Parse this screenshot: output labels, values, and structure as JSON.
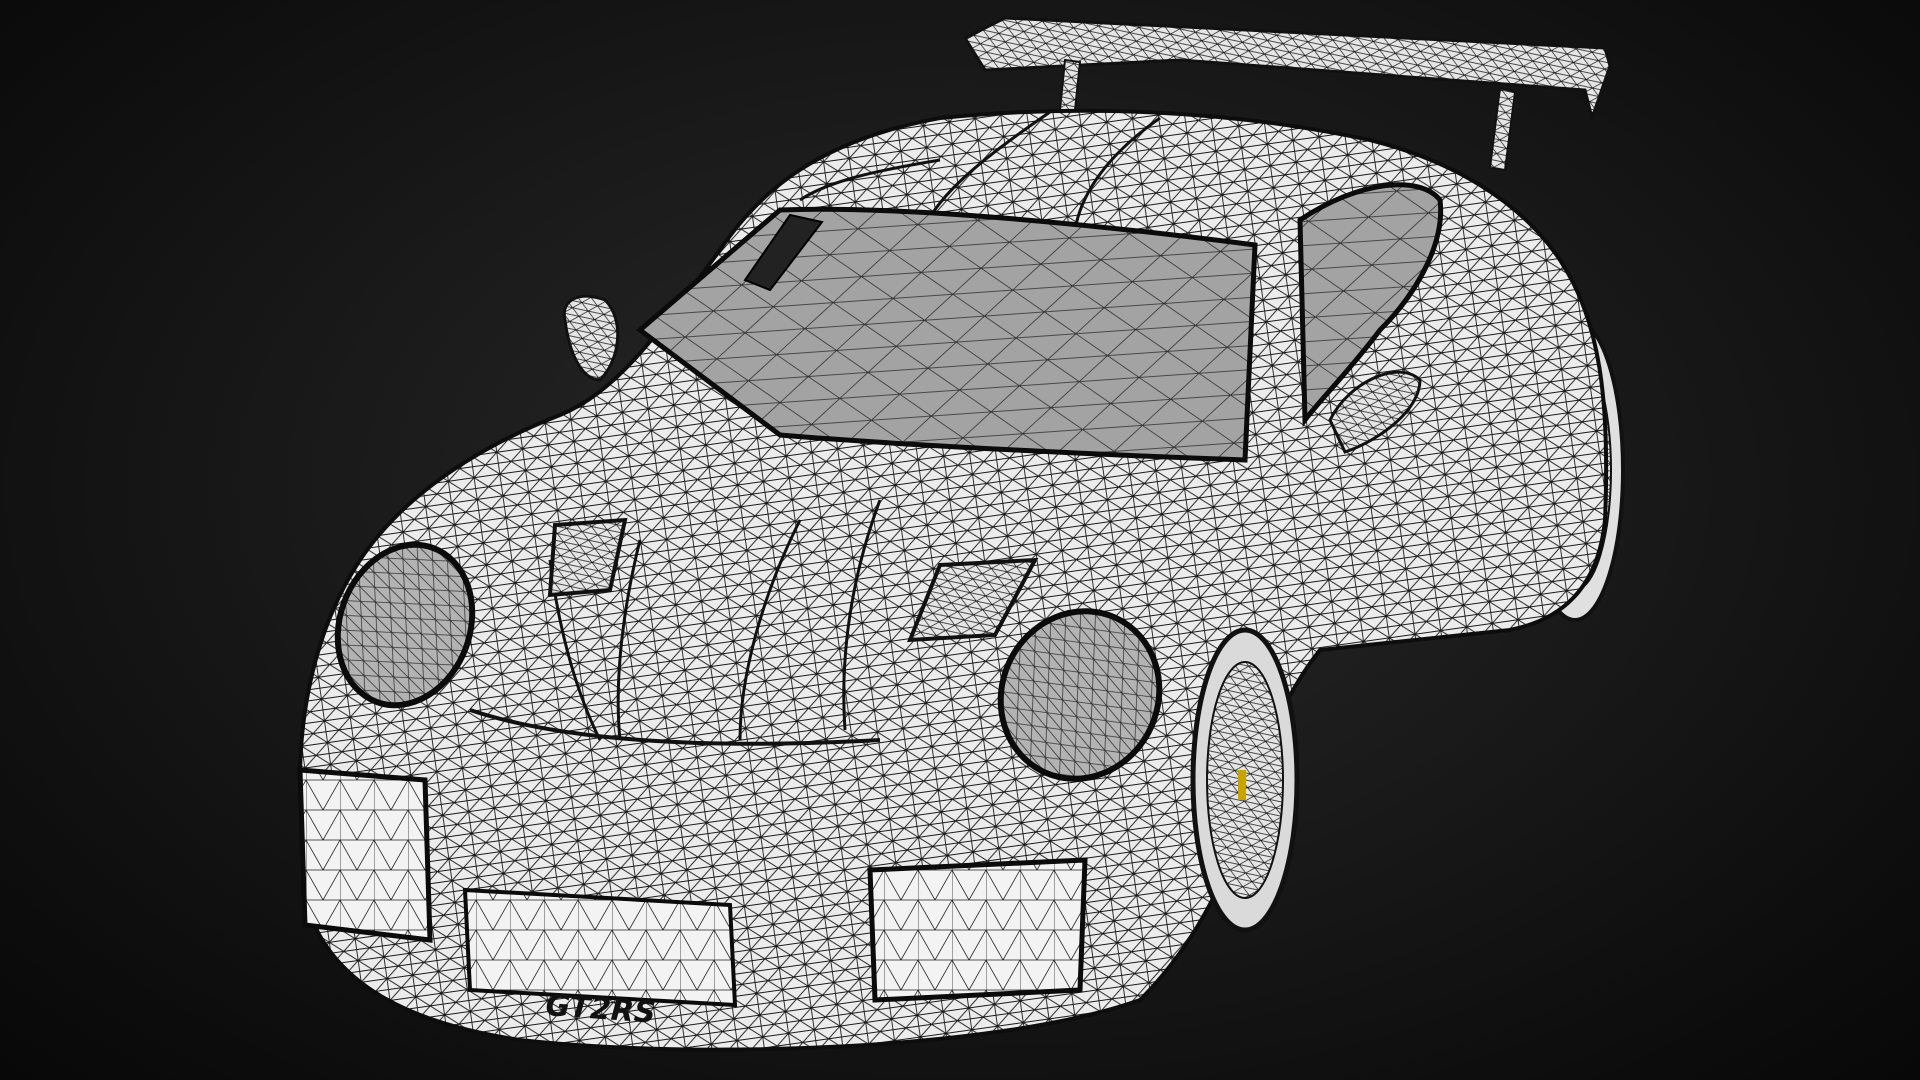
{
  "scene": {
    "background_color": "#141414",
    "mesh_fill": "#e9e9e9",
    "mesh_line": "#111111",
    "glass_fill": "#9c9c9c",
    "accent_yellow": "#c9a400"
  },
  "car": {
    "badge_text": "GT2RS"
  }
}
